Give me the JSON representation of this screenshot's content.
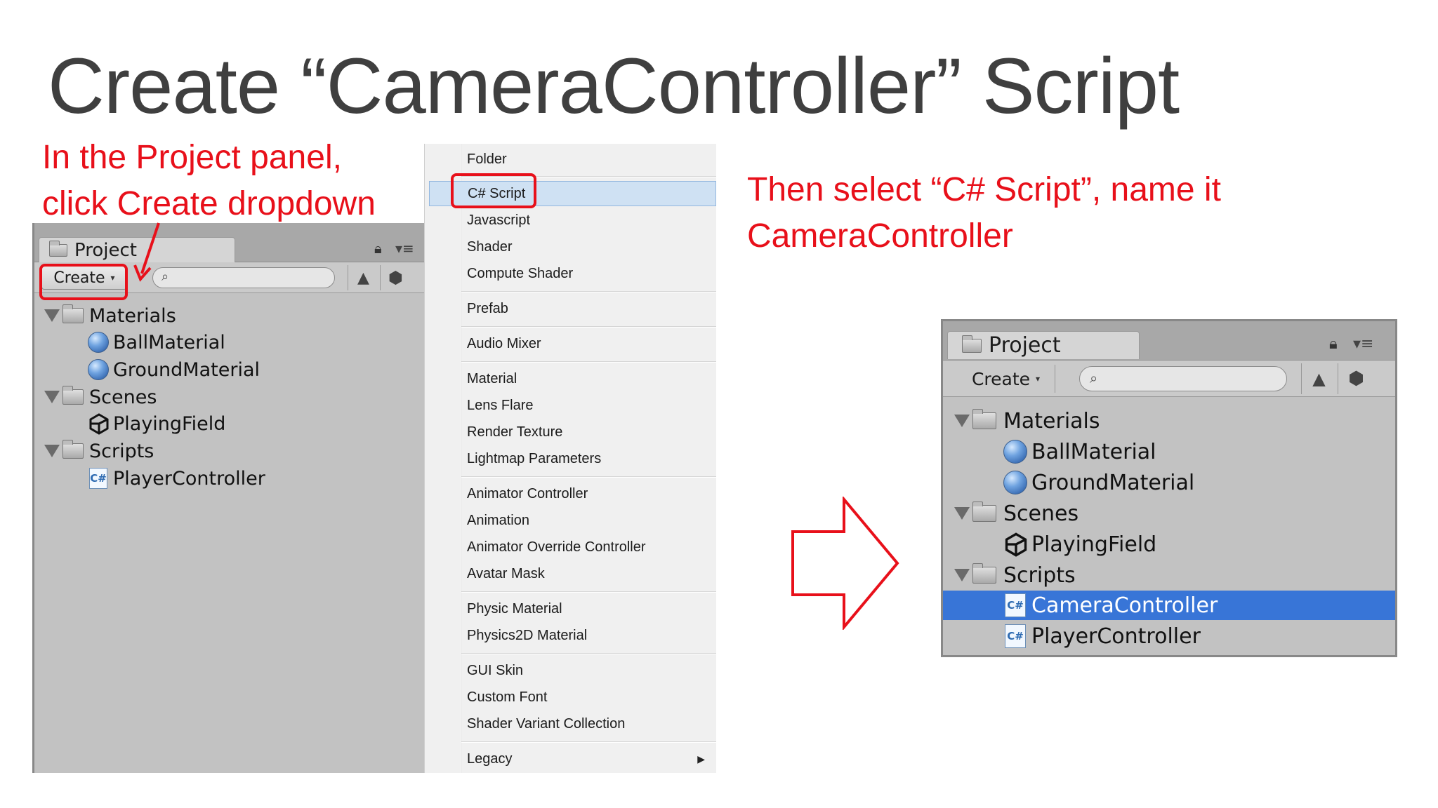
{
  "slide": {
    "title": "Create “CameraController” Script",
    "caption_left_line1": "In the Project panel,",
    "caption_left_line2": "click Create dropdown",
    "caption_right_line1": "Then select “C# Script”, name it",
    "caption_right_line2": "CameraController"
  },
  "colors": {
    "annotation": "#e8101a",
    "selection": "#3875d7",
    "panel": "#c2c2c2"
  },
  "project_panel_before": {
    "tab_label": "Project",
    "create_label": "Create",
    "icons": [
      "folder-icon",
      "lock-icon",
      "panel-menu-icon",
      "search-icon",
      "filter-by-type-icon",
      "filter-by-label-icon"
    ],
    "tree": {
      "materials": "Materials",
      "ball_material": "BallMaterial",
      "ground_material": "GroundMaterial",
      "scenes": "Scenes",
      "playing_field": "PlayingField",
      "scripts": "Scripts",
      "player_controller": "PlayerController"
    }
  },
  "create_menu": {
    "folder": "Folder",
    "csharp_script": "C# Script",
    "javascript": "Javascript",
    "shader": "Shader",
    "compute_shader": "Compute Shader",
    "prefab": "Prefab",
    "audio_mixer": "Audio Mixer",
    "material": "Material",
    "lens_flare": "Lens Flare",
    "render_texture": "Render Texture",
    "lightmap_parameters": "Lightmap Parameters",
    "animator_controller": "Animator Controller",
    "animation": "Animation",
    "animator_override_controller": "Animator Override Controller",
    "avatar_mask": "Avatar Mask",
    "physic_material": "Physic Material",
    "physics2d_material": "Physics2D Material",
    "gui_skin": "GUI Skin",
    "custom_font": "Custom Font",
    "shader_variant_collection": "Shader Variant Collection",
    "legacy": "Legacy",
    "selected_item": "C# Script"
  },
  "project_panel_after": {
    "tab_label": "Project",
    "create_label": "Create",
    "tree": {
      "materials": "Materials",
      "ball_material": "BallMaterial",
      "ground_material": "GroundMaterial",
      "scenes": "Scenes",
      "playing_field": "PlayingField",
      "scripts": "Scripts",
      "camera_controller": "CameraController",
      "player_controller": "PlayerController"
    },
    "selected_item": "CameraController"
  }
}
